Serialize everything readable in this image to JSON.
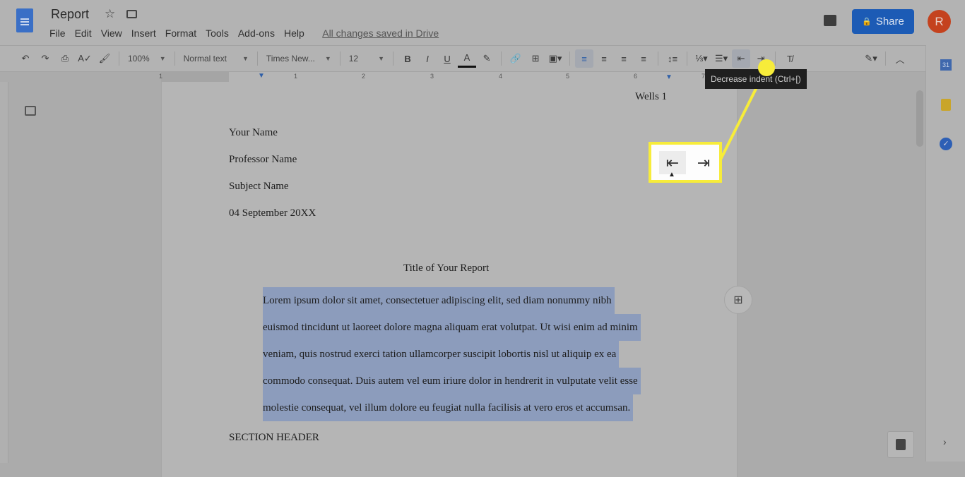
{
  "header": {
    "title": "Report",
    "menus": [
      "File",
      "Edit",
      "View",
      "Insert",
      "Format",
      "Tools",
      "Add-ons",
      "Help"
    ],
    "save_status": "All changes saved in Drive",
    "share_label": "Share",
    "avatar_letter": "R"
  },
  "toolbar": {
    "zoom": "100%",
    "style": "Normal text",
    "font": "Times New...",
    "size": "12",
    "tooltip": "Decrease indent (Ctrl+[)"
  },
  "ruler": {
    "labels": [
      "1",
      "1",
      "2",
      "3",
      "4",
      "5",
      "6",
      "7"
    ]
  },
  "document": {
    "header_right": "Wells 1",
    "lines": [
      "Your Name",
      "Professor Name",
      "Subject Name",
      "04 September 20XX"
    ],
    "title": "Title of Your Report",
    "selected_lines": [
      "Lorem ipsum dolor sit amet, consectetuer adipiscing elit, sed diam nonummy nibh",
      "euismod tincidunt ut laoreet dolore magna aliquam erat volutpat. Ut wisi enim ad minim",
      "veniam, quis nostrud exerci tation ullamcorper suscipit lobortis nisl ut aliquip ex ea",
      "commodo consequat. Duis autem vel eum iriure dolor in hendrerit in vulputate velit esse",
      "molestie consequat, vel illum dolore eu feugiat nulla facilisis at vero eros et accumsan."
    ],
    "section_header": "SECTION HEADER"
  },
  "colors": {
    "highlight": "#f7ec3a",
    "share": "#1c5bb5",
    "avatar": "#c4421e",
    "selection": "#8c9cbc"
  }
}
